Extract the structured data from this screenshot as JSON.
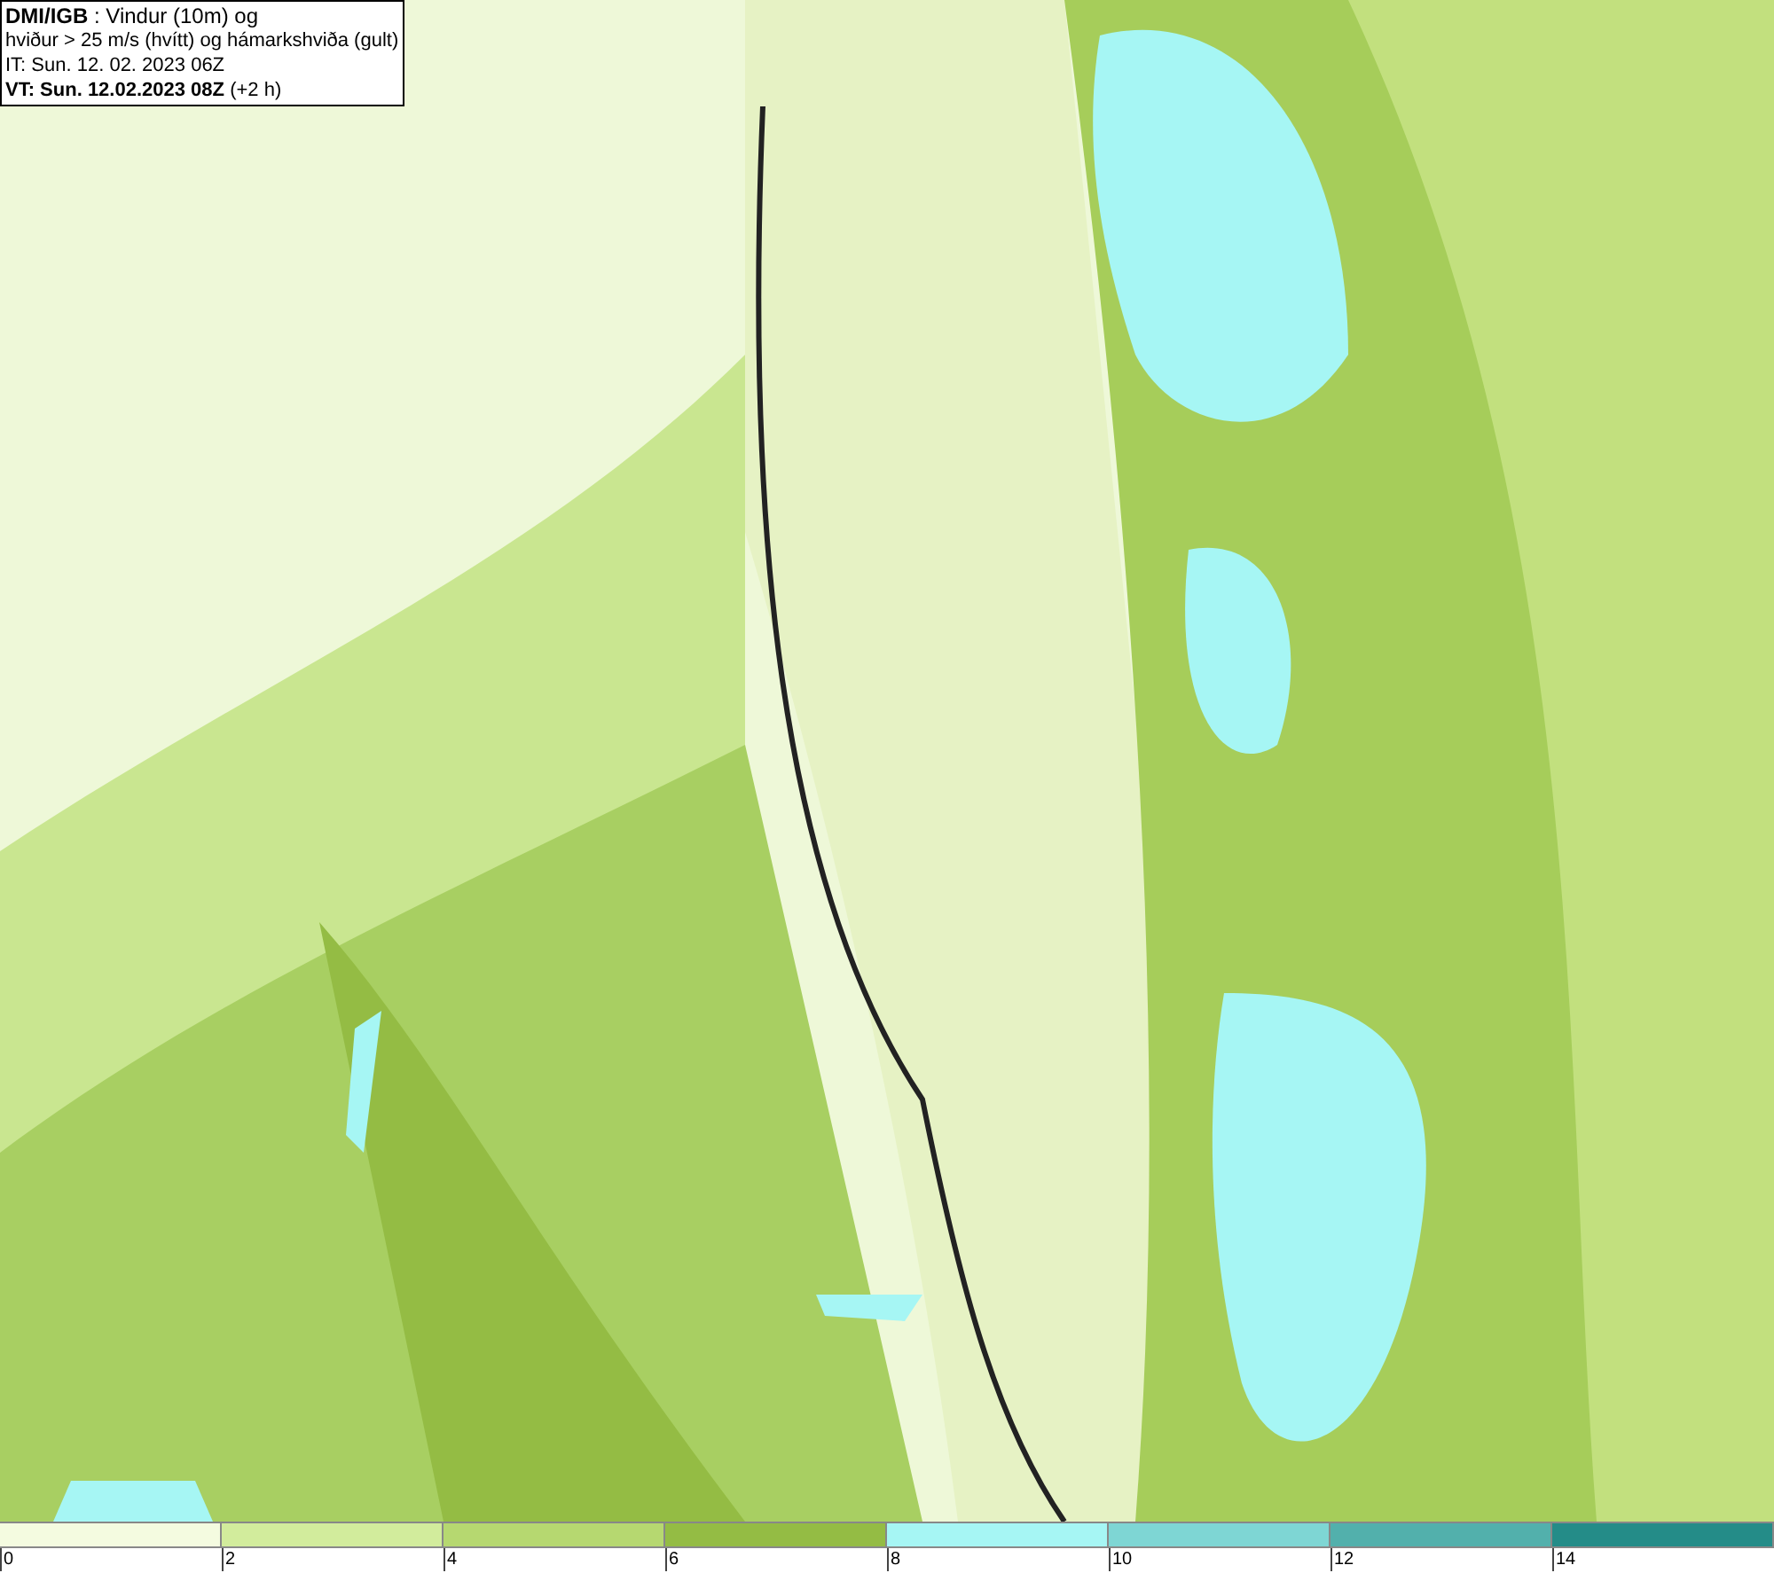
{
  "title_box": {
    "lines": [
      "**DMI/IGB** : Vindur (10m) og",
      "hviður > 25 m/s (hvítt) og hámarkshviða (gult)",
      "IT: Sun. 12. 02. 2023 06Z",
      "**VT: Sun. 12.02.2023 08Z** (+2 h)"
    ]
  },
  "color_scale": {
    "segments": [
      {
        "color": "#f4fbe0"
      },
      {
        "color": "#d2ec9c"
      },
      {
        "color": "#b6d870"
      },
      {
        "color": "#94bc44"
      },
      {
        "color": "#a6f6f4"
      },
      {
        "color": "#7ed6d4"
      },
      {
        "color": "#52b0ac"
      },
      {
        "color": "#248c88"
      }
    ],
    "ticks": [
      "0",
      "2",
      "4",
      "6",
      "8",
      "10",
      "12",
      "14"
    ]
  }
}
